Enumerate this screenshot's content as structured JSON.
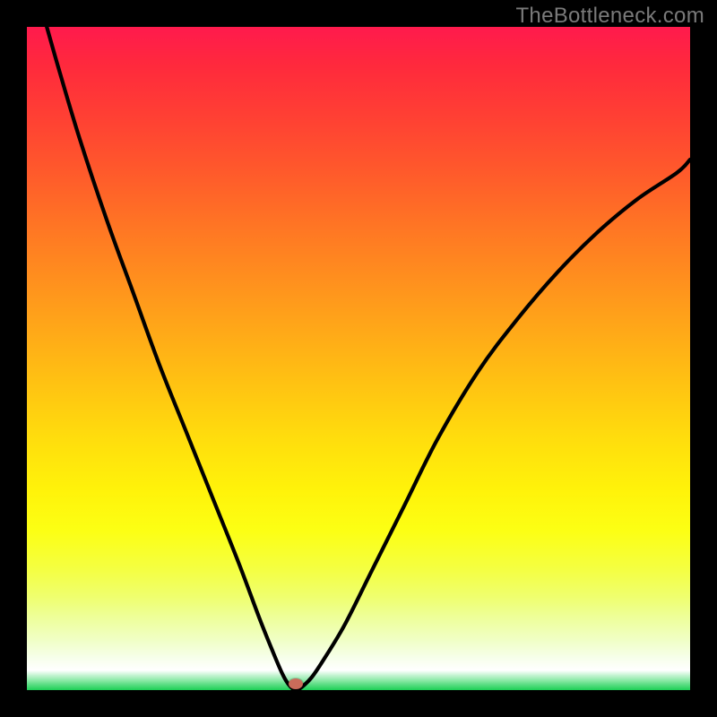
{
  "watermark": "TheBottleneck.com",
  "marker": {
    "x_pct": 40.5,
    "y_pct": 99.1,
    "color": "#c96c5a"
  },
  "chart_data": {
    "type": "line",
    "title": "",
    "xlabel": "",
    "ylabel": "",
    "xlim": [
      0,
      100
    ],
    "ylim": [
      0,
      100
    ],
    "series": [
      {
        "name": "bottleneck-curve",
        "x": [
          3,
          5,
          8,
          12,
          16,
          20,
          24,
          28,
          32,
          35,
          37,
          38.5,
          39.5,
          40.5,
          41.5,
          43,
          45,
          48,
          52,
          57,
          62,
          68,
          74,
          80,
          86,
          92,
          98,
          100
        ],
        "y": [
          100,
          93,
          83,
          71,
          60,
          49,
          39,
          29,
          19,
          11,
          6,
          2.5,
          0.8,
          0,
          0.5,
          2,
          5,
          10,
          18,
          28,
          38,
          48,
          56,
          63,
          69,
          74,
          78,
          80
        ]
      }
    ],
    "optimum_marker": {
      "x": 40.5,
      "y": 0
    },
    "background_color_scale": {
      "top": "high-bottleneck-red",
      "middle": "yellow",
      "bottom": "no-bottleneck-green"
    }
  }
}
